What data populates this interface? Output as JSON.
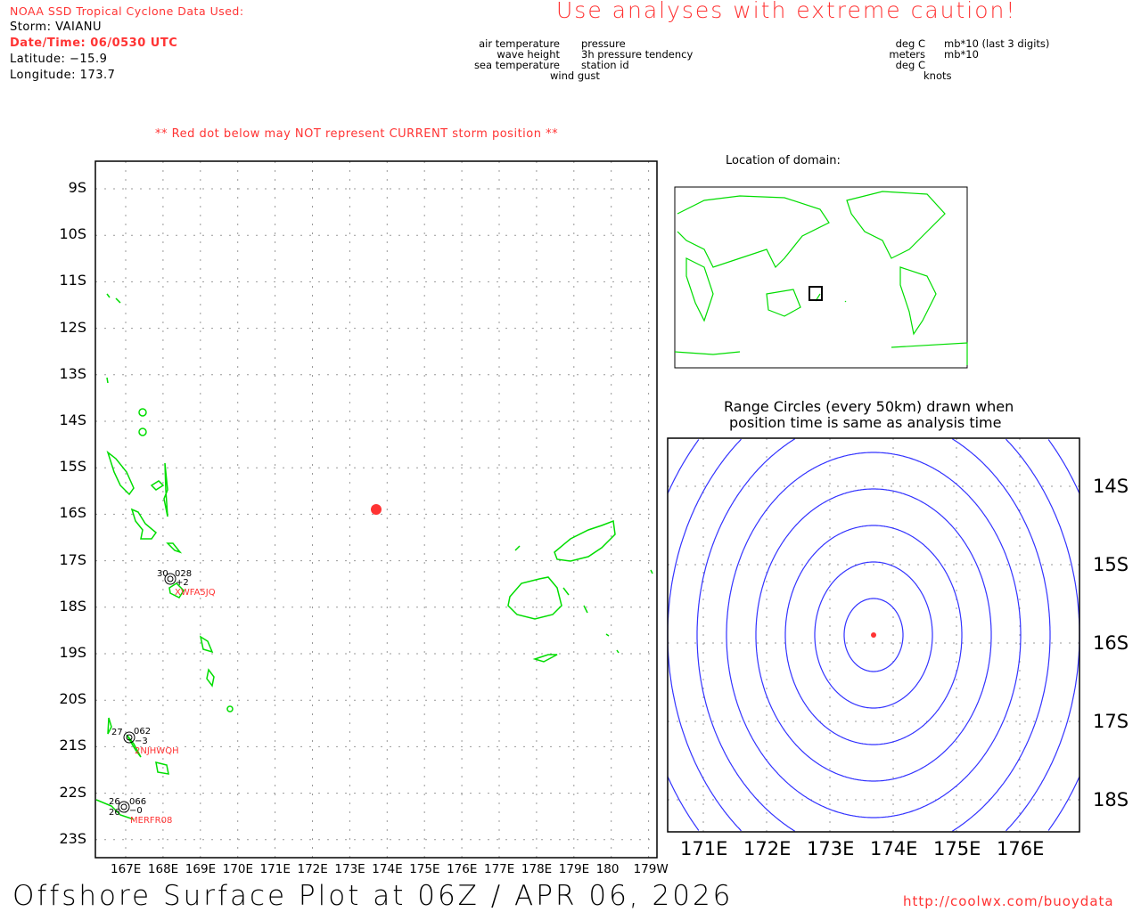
{
  "header": {
    "source": "NOAA SSD Tropical Cyclone Data Used:",
    "storm": "Storm: VAIANU",
    "datetime": "Date/Time: 06/0530 UTC",
    "latitude": "Latitude: −15.9",
    "longitude": "Longitude: 173.7",
    "caution": "Use analyses with extreme caution!"
  },
  "legend": {
    "left": [
      "air temperature",
      "wave height",
      "sea temperature"
    ],
    "right": [
      "pressure",
      "3h pressure tendency",
      "station id"
    ],
    "bottom": "wind gust",
    "units_left": [
      "deg C",
      "meters",
      "deg C"
    ],
    "units_right": [
      "mb*10 (last 3 digits)",
      "mb*10"
    ],
    "units_bottom": "knots"
  },
  "warning": "** Red dot below may NOT represent CURRENT storm position **",
  "main_map": {
    "lat_labels": [
      "9S",
      "10S",
      "11S",
      "12S",
      "13S",
      "14S",
      "15S",
      "16S",
      "17S",
      "18S",
      "19S",
      "20S",
      "21S",
      "22S",
      "23S"
    ],
    "lon_labels": [
      "167E",
      "168E",
      "169E",
      "170E",
      "171E",
      "172E",
      "173E",
      "174E",
      "175E",
      "176E",
      "177E",
      "178E",
      "179E",
      "180",
      "179W"
    ],
    "stations": [
      {
        "id": "XWFA5JQ",
        "air": "30",
        "pressure": "028",
        "tendency": "+2"
      },
      {
        "id": "2NJHWQH",
        "air": "27",
        "pressure": "062",
        "tendency": "−3"
      },
      {
        "id": "MERFR08",
        "air": "26",
        "sea": "26",
        "pressure": "066",
        "tendency": "−0"
      }
    ]
  },
  "inset": {
    "title": "Location of domain:"
  },
  "range": {
    "title1": "Range Circles (every 50km) drawn when",
    "title2": "position time is same as analysis time",
    "lat_labels": [
      "14S",
      "15S",
      "16S",
      "17S",
      "18S"
    ],
    "lon_labels": [
      "171E",
      "172E",
      "173E",
      "174E",
      "175E",
      "176E"
    ]
  },
  "footer": {
    "title": "Offshore Surface Plot at 06Z / APR 06, 2026",
    "url": "http://coolwx.com/buoydata"
  },
  "colors": {
    "land": "#00dd00",
    "storm": "#ff3333",
    "circles": "#3333ff"
  }
}
